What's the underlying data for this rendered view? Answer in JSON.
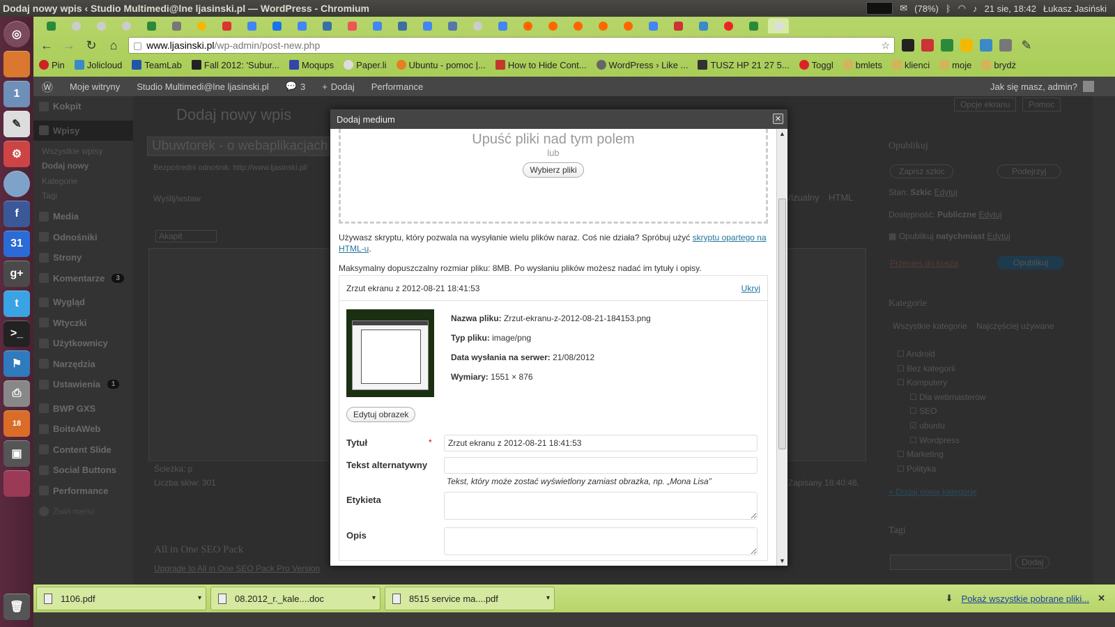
{
  "window": {
    "title": "Dodaj nowy wpis ‹ Studio Multimedi@lne ljasinski.pl — WordPress - Chromium",
    "battery": "(78%)",
    "datetime": "21 sie, 18:42",
    "user": "Łukasz Jasiński"
  },
  "launcher": {
    "badge_count": "18",
    "calendar_day": "31"
  },
  "browser": {
    "url_host": "www.ljasinski.pl",
    "url_path": "/wp-admin/post-new.php",
    "bookmarks": [
      "Pin",
      "Jolicloud",
      "TeamLab",
      "Fall 2012: 'Subur...",
      "Moqups",
      "Paper.li",
      "Ubuntu - pomoc |...",
      "How to Hide Cont...",
      "WordPress › Like ...",
      "TUSZ HP 21 27 5...",
      "Toggl",
      "bmlets",
      "klienci",
      "moje",
      "brydż"
    ]
  },
  "wpbar": {
    "my_sites": "Moje witryny",
    "site": "Studio Multimedi@lne ljasinski.pl",
    "comments": "3",
    "add": "Dodaj",
    "performance": "Performance",
    "greeting": "Jak się masz, admin?"
  },
  "menu": {
    "dashboard": "Kokpit",
    "posts": "Wpisy",
    "sub": [
      "Wszystkie wpisy",
      "Dodaj nowy",
      "Kategorie",
      "Tagi"
    ],
    "items": [
      {
        "label": "Media"
      },
      {
        "label": "Odnośniki"
      },
      {
        "label": "Strony"
      },
      {
        "label": "Komentarze",
        "count": "3"
      },
      {
        "label": "Wygląd"
      },
      {
        "label": "Wtyczki"
      },
      {
        "label": "Użytkownicy"
      },
      {
        "label": "Narzędzia"
      },
      {
        "label": "Ustawienia",
        "count": "1"
      },
      {
        "label": "BWP GXS"
      },
      {
        "label": "BoiteAWeb"
      },
      {
        "label": "Content Slide"
      },
      {
        "label": "Social Buttons"
      },
      {
        "label": "Performance"
      }
    ],
    "collapse": "Zwiń menu"
  },
  "background": {
    "page_title": "Dodaj nowy wpis",
    "post_title": "Ubuwtorek - o webaplikacjach",
    "permalink": "Bezpośredni odnośnik: http://www.ljasinski.pl/",
    "upload_insert": "Wyślij/wstaw",
    "paragraph_select": "Akapit",
    "tab_visual": "Wizualny",
    "tab_html": "HTML",
    "path": "Ścieżka: p",
    "word_count": "Liczba słów: 301",
    "saved": "Zapisany 18:40:46.",
    "screen_options": "Opcje ekranu",
    "help": "Pomoc",
    "seo_title": "All in One SEO Pack",
    "seo_link": "Upgrade to All in One SEO Pack Pro Version",
    "publish_box": "Opublikuj",
    "save_draft": "Zapisz szkic",
    "preview": "Podejrzyj",
    "status_label": "Stan:",
    "status_value": "Szkic",
    "visibility_label": "Dostępność:",
    "visibility_value": "Publiczne",
    "publish_label": "Opublikuj",
    "publish_value": "natychmiast",
    "edit": "Edytuj",
    "trash": "Przenieś do kosza",
    "publish_btn": "Opublikuj",
    "categories_box": "Kategorie",
    "all_categories": "Wszystkie kategorie",
    "most_used": "Najczęściej używane",
    "categories": [
      "Android",
      "Bez kategorii",
      "Komputery",
      "Dla webmasterów",
      "SEO",
      "ubuntu",
      "Wordpress",
      "Marketing",
      "Polityka"
    ],
    "add_category": "+ Dodaj nową kategorię",
    "tags_box": "Tagi",
    "add_tag": "Dodaj"
  },
  "modal": {
    "title": "Dodaj medium",
    "drop_text": "Upuść pliki nad tym polem",
    "or": "lub",
    "select_files": "Wybierz pliki",
    "multi_info_1": "Używasz skryptu, który pozwala na wysyłanie wielu plików naraz. Coś nie działa? Spróbuj użyć ",
    "multi_info_link": "skryptu opartego na HTML-u",
    "multi_info_2": ".",
    "max_size": "Maksymalny dopuszczalny rozmiar pliku: 8MB. Po wysłaniu plików możesz nadać im tytuły i opisy.",
    "file_title": "Zrzut ekranu z 2012-08-21 18:41:53",
    "hide": "Ukryj",
    "filename_label": "Nazwa pliku:",
    "filename": "Zrzut-ekranu-z-2012-08-21-184153.png",
    "filetype_label": "Typ pliku:",
    "filetype": "image/png",
    "upload_date_label": "Data wysłania na serwer:",
    "upload_date": "21/08/2012",
    "dimensions_label": "Wymiary:",
    "dimensions": "1551 × 876",
    "edit_image": "Edytuj obrazek",
    "title_label": "Tytuł",
    "required_mark": "*",
    "title_value": "Zrzut ekranu z 2012-08-21 18:41:53",
    "alt_label": "Tekst alternatywny",
    "alt_help": "Tekst, który może zostać wyświetlony zamiast obrazka, np. „Mona Lisa”",
    "caption_label": "Etykieta",
    "description_label": "Opis"
  },
  "downloads": {
    "items": [
      "1106.pdf",
      "08.2012_r._kale....doc",
      "8515 service ma....pdf"
    ],
    "show_all": "Pokaż wszystkie pobrane pliki..."
  }
}
